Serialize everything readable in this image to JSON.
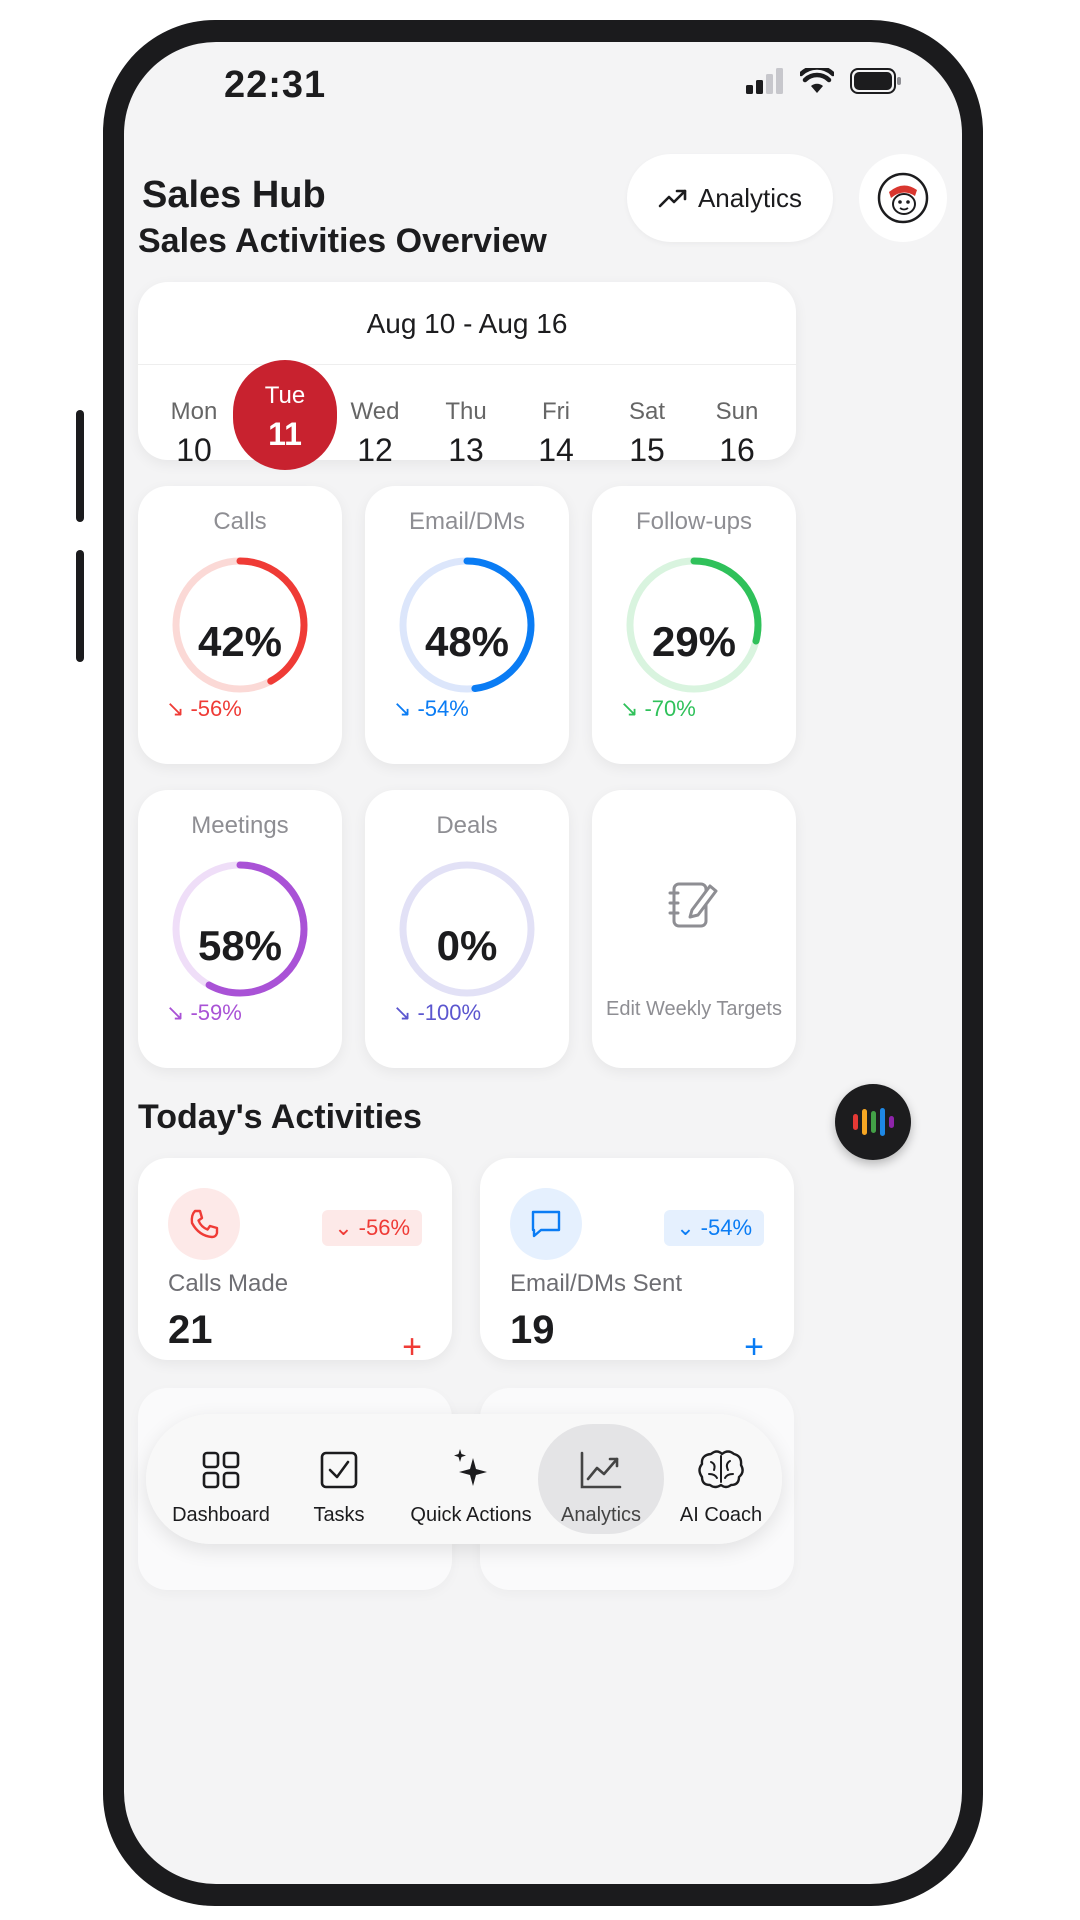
{
  "status": {
    "time": "22:31"
  },
  "header": {
    "title": "Sales Hub",
    "analytics_label": "Analytics"
  },
  "overview": {
    "title": "Sales Activities Overview",
    "week_range": "Aug 10 - Aug 16",
    "days": [
      {
        "name": "Mon",
        "num": "10"
      },
      {
        "name": "Tue",
        "num": "11",
        "selected": true
      },
      {
        "name": "Wed",
        "num": "12"
      },
      {
        "name": "Thu",
        "num": "13"
      },
      {
        "name": "Fri",
        "num": "14"
      },
      {
        "name": "Sat",
        "num": "15"
      },
      {
        "name": "Sun",
        "num": "16"
      }
    ],
    "metrics": [
      {
        "title": "Calls",
        "percent": "42%",
        "progress": 0.42,
        "delta": "-56%",
        "color": "#ef3b36",
        "track": "#fbd9d6"
      },
      {
        "title": "Email/DMs",
        "percent": "48%",
        "progress": 0.48,
        "delta": "-54%",
        "color": "#0a7cf4",
        "track": "#dce6fb"
      },
      {
        "title": "Follow-ups",
        "percent": "29%",
        "progress": 0.29,
        "delta": "-70%",
        "color": "#2fc15a",
        "track": "#d9f4df"
      },
      {
        "title": "Meetings",
        "percent": "58%",
        "progress": 0.58,
        "delta": "-59%",
        "color": "#a952d6",
        "track": "#efdef8"
      },
      {
        "title": "Deals",
        "percent": "0%",
        "progress": 0,
        "delta": "-100%",
        "color": "#5b56cf",
        "track": "#e2e1f6"
      }
    ],
    "edit_targets_label": "Edit Weekly Targets"
  },
  "today": {
    "title": "Today's Activities",
    "cards": [
      {
        "label": "Calls Made",
        "value": "21",
        "badge": "-56%",
        "color": "#ef3b36",
        "icon": "phone-icon"
      },
      {
        "label": "Email/DMs Sent",
        "value": "19",
        "badge": "-54%",
        "color": "#0a7cf4",
        "icon": "message-icon"
      }
    ]
  },
  "tabbar": {
    "tabs": [
      {
        "label": "Dashboard",
        "icon": "grid-icon"
      },
      {
        "label": "Tasks",
        "icon": "checkbox-icon"
      },
      {
        "label": "Quick Actions",
        "icon": "sparkles-icon"
      },
      {
        "label": "Analytics",
        "icon": "trend-chart-icon",
        "active": true
      },
      {
        "label": "AI Coach",
        "icon": "brain-icon"
      }
    ]
  }
}
